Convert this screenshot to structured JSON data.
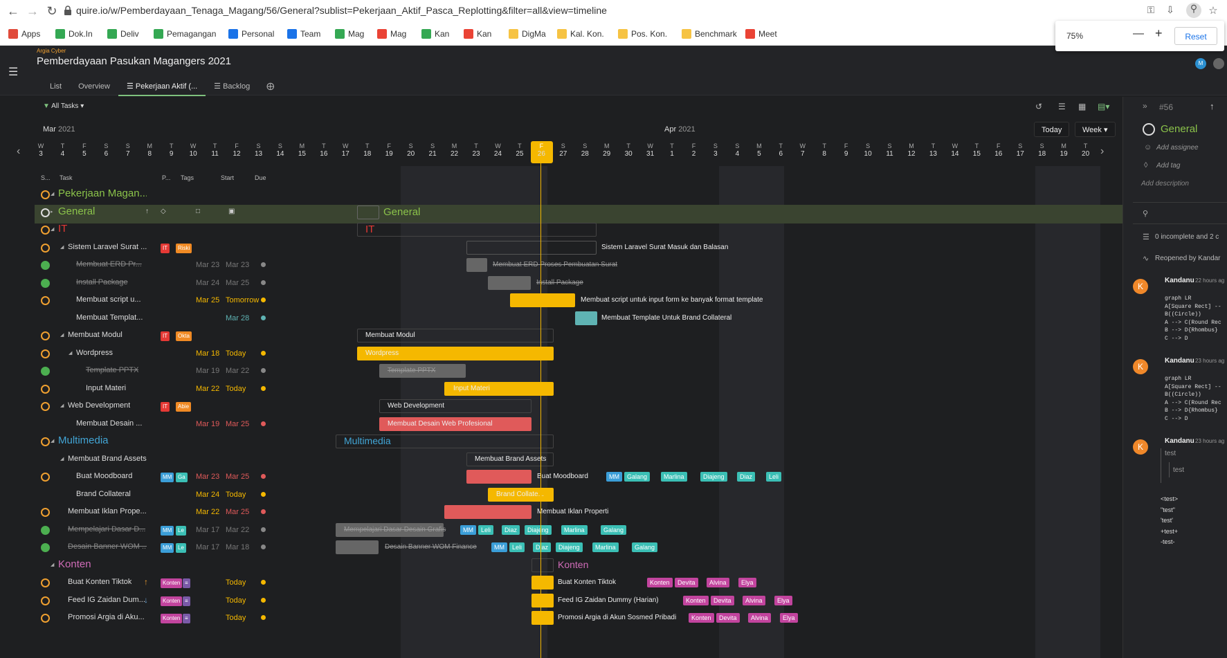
{
  "browser": {
    "url": "quire.io/w/Pemberdayaan_Tenaga_Magang/56/General?sublist=Pekerjaan_Aktif_Pasca_Replotting&filter=all&view=timeline",
    "bookmarks": [
      "Apps",
      "Dok.In",
      "Deliv",
      "Pemagangan",
      "Personal",
      "Team",
      "Mag",
      "Mag",
      "Kan",
      "Kan",
      "DigMa",
      "Kal. Kon.",
      "Pos. Kon.",
      "Benchmark",
      "Meet"
    ],
    "zoom": {
      "level": "75%",
      "minus": "—",
      "plus": "+",
      "reset": "Reset"
    }
  },
  "header": {
    "org": "Argia Cyber",
    "project": "Pemberdayaan Pasukan Magangers 2021",
    "tabs": [
      "List",
      "Overview",
      "Pekerjaan Aktif (...",
      "Backlog"
    ],
    "avatar": "M"
  },
  "toolbar": {
    "filter": "All Tasks",
    "today": "Today",
    "view": "Week"
  },
  "timeline": {
    "months": [
      {
        "name": "Mar",
        "year": "2021"
      },
      {
        "name": "Apr",
        "year": "2021"
      }
    ],
    "days": [
      [
        "W",
        "3"
      ],
      [
        "T",
        "4"
      ],
      [
        "F",
        "5"
      ],
      [
        "S",
        "6"
      ],
      [
        "S",
        "7"
      ],
      [
        "M",
        "8"
      ],
      [
        "T",
        "9"
      ],
      [
        "W",
        "10"
      ],
      [
        "T",
        "11"
      ],
      [
        "F",
        "12"
      ],
      [
        "S",
        "13"
      ],
      [
        "S",
        "14"
      ],
      [
        "M",
        "15"
      ],
      [
        "T",
        "16"
      ],
      [
        "W",
        "17"
      ],
      [
        "T",
        "18"
      ],
      [
        "F",
        "19"
      ],
      [
        "S",
        "20"
      ],
      [
        "S",
        "21"
      ],
      [
        "M",
        "22"
      ],
      [
        "T",
        "23"
      ],
      [
        "W",
        "24"
      ],
      [
        "T",
        "25"
      ],
      [
        "F",
        "26"
      ],
      [
        "S",
        "27"
      ],
      [
        "S",
        "28"
      ],
      [
        "M",
        "29"
      ],
      [
        "T",
        "30"
      ],
      [
        "W",
        "31"
      ],
      [
        "T",
        "1"
      ],
      [
        "F",
        "2"
      ],
      [
        "S",
        "3"
      ],
      [
        "S",
        "4"
      ],
      [
        "M",
        "5"
      ],
      [
        "T",
        "6"
      ],
      [
        "W",
        "7"
      ],
      [
        "T",
        "8"
      ],
      [
        "F",
        "9"
      ],
      [
        "S",
        "10"
      ],
      [
        "S",
        "11"
      ],
      [
        "M",
        "12"
      ],
      [
        "T",
        "13"
      ],
      [
        "W",
        "14"
      ],
      [
        "T",
        "15"
      ],
      [
        "F",
        "16"
      ],
      [
        "S",
        "17"
      ],
      [
        "S",
        "18"
      ],
      [
        "M",
        "19"
      ],
      [
        "T",
        "20"
      ]
    ],
    "today_index": 23
  },
  "columns": {
    "status": "S...",
    "task": "Task",
    "priority": "P...",
    "tags": "Tags",
    "start": "Start",
    "due": "Due"
  },
  "rows": [
    {
      "name": "Pekerjaan Magan...",
      "level": 0,
      "type": "section",
      "color": "#8bc34a",
      "status": "orange"
    },
    {
      "name": "General",
      "level": 0,
      "type": "section",
      "color": "#8bc34a",
      "status": "open",
      "selected": true
    },
    {
      "name": "IT",
      "level": 0,
      "type": "section",
      "color": "#e53935",
      "status": "orange"
    },
    {
      "name": "Sistem Laravel Surat ...",
      "level": 1,
      "status": "orange",
      "tags": [
        "IT",
        "Riski"
      ]
    },
    {
      "name": "Membuat ERD Pr...",
      "level": 2,
      "status": "done",
      "strike": true,
      "start": "Mar 23",
      "due": "Mar 23",
      "dot": "#888"
    },
    {
      "name": "Install Package",
      "level": 2,
      "status": "done",
      "strike": true,
      "start": "Mar 24",
      "due": "Mar 25",
      "dot": "#888"
    },
    {
      "name": "Membuat script u...",
      "level": 2,
      "status": "orange",
      "start": "Mar 25",
      "due": "Tomorrow",
      "dot": "#f5b800"
    },
    {
      "name": "Membuat Templat...",
      "level": 2,
      "status": "none",
      "start": "",
      "due": "Mar 28",
      "dot": "#5fb3b3"
    },
    {
      "name": "Membuat Modul",
      "level": 1,
      "status": "orange",
      "tags": [
        "IT",
        "Okta"
      ]
    },
    {
      "name": "Wordpress",
      "level": 2,
      "status": "orange",
      "start": "Mar 18",
      "due": "Today",
      "dot": "#f5b800"
    },
    {
      "name": "Template PPTX",
      "level": 3,
      "status": "done",
      "strike": true,
      "start": "Mar 19",
      "due": "Mar 22",
      "dot": "#888"
    },
    {
      "name": "Input Materi",
      "level": 3,
      "status": "orange",
      "start": "Mar 22",
      "due": "Today",
      "dot": "#f5b800"
    },
    {
      "name": "Web Development",
      "level": 1,
      "status": "orange",
      "tags": [
        "IT",
        "Abie"
      ]
    },
    {
      "name": "Membuat Desain ...",
      "level": 2,
      "status": "none",
      "start": "Mar 19",
      "due": "Mar 25",
      "dot": "#e05a5a"
    },
    {
      "name": "Multimedia",
      "level": 0,
      "type": "section",
      "color": "#42a5d5",
      "status": "orange"
    },
    {
      "name": "Membuat Brand Assets",
      "level": 1,
      "status": "none"
    },
    {
      "name": "Buat Moodboard",
      "level": 2,
      "status": "orange",
      "tags": [
        "MM",
        "Ga"
      ],
      "start": "Mar 23",
      "due": "Mar 25",
      "dot": "#e05a5a"
    },
    {
      "name": "Brand Collateral",
      "level": 2,
      "status": "none",
      "start": "Mar 24",
      "due": "Today",
      "dot": "#f5b800"
    },
    {
      "name": "Membuat Iklan Prope...",
      "level": 1,
      "status": "orange",
      "start": "Mar 22",
      "due": "Mar 25",
      "dot": "#e05a5a"
    },
    {
      "name": "Mempelajari Dasar D...",
      "level": 1,
      "status": "done",
      "strike": true,
      "tags": [
        "MM",
        "Le"
      ],
      "start": "Mar 17",
      "due": "Mar 22",
      "dot": "#888"
    },
    {
      "name": "Desain Banner WOM ...",
      "level": 1,
      "status": "done",
      "strike": true,
      "tags": [
        "MM",
        "Le"
      ],
      "start": "Mar 17",
      "due": "Mar 18",
      "dot": "#888"
    },
    {
      "name": "Konten",
      "level": 0,
      "type": "section",
      "color": "#d06cb8",
      "status": "none"
    },
    {
      "name": "Buat Konten Tiktok",
      "level": 1,
      "status": "orange",
      "priority": "↑",
      "tags": [
        "Konten",
        "≡"
      ],
      "due": "Today",
      "dot": "#f5b800"
    },
    {
      "name": "Feed IG Zaidan Dum...",
      "level": 1,
      "status": "orange",
      "priority": "↓",
      "tags": [
        "Konten",
        "≡"
      ],
      "due": "Today",
      "dot": "#f5b800"
    },
    {
      "name": "Promosi Argia di Aku...",
      "level": 1,
      "status": "orange",
      "tags": [
        "Konten",
        "≡"
      ],
      "due": "Today",
      "dot": "#f5b800"
    }
  ],
  "gantt_labels": {
    "general": "General",
    "it": "IT",
    "sistem": "Sistem Laravel Surat Masuk dan Balasan",
    "erd": "Membuat ERD Proses Pembuatan Surat",
    "install": "Install Package",
    "script": "Membuat script untuk input form ke banyak format template",
    "template": "Membuat Template Untuk Brand Collateral",
    "modul": "Membuat Modul",
    "wordpress": "Wordpress",
    "pptx": "Template PPTX",
    "materi": "Input Materi",
    "webdev": "Web Development",
    "desain": "Membuat Desain Web Profesional",
    "multimedia": "Multimedia",
    "brand": "Membuat Brand Assets",
    "moodboard": "Buat Moodboard",
    "collateral": "Brand Collate...",
    "iklan": "Membuat Iklan Properti",
    "mempelajari": "Mempelajari Dasar Desain Grafis",
    "banner": "Desain Banner WOM Finance",
    "konten": "Konten",
    "tiktok": "Buat Konten Tiktok",
    "feed": "Feed IG Zaidan Dummy (Harian)",
    "promosi": "Promosi Argia di Akun Sosmed Pribadi"
  },
  "chips": {
    "mm": "MM",
    "galang": "Galang",
    "marlina": "Marlina",
    "diajeng": "Diajeng",
    "diaz": "Diaz",
    "leli": "Leli",
    "konten": "Konten",
    "devita": "Devita",
    "alvina": "Alvina",
    "elya": "Elya"
  },
  "panel": {
    "num": "#56",
    "title": "General",
    "assignee": "Add assignee",
    "tag": "Add tag",
    "desc": "Add description",
    "subtasks": "0 incomplete and 2 c",
    "activity": "Reopened by Kandar",
    "comments": [
      {
        "author": "Kandanu",
        "time": "22 hours ag",
        "avatar": "K"
      },
      {
        "author": "Kandanu",
        "time": "23 hours ag",
        "avatar": "K"
      },
      {
        "author": "Kandanu",
        "time": "23 hours ag",
        "avatar": "K"
      }
    ],
    "code": "graph LR\nA[Square Rect] --\nB((Circle))\nA --> C(Round Rec\nB --> D{Rhombus}\nC --> D",
    "test1": "test",
    "test2": "test",
    "tail": "<test>\n\"test\"\n'test'\n+test+\n-test-"
  }
}
